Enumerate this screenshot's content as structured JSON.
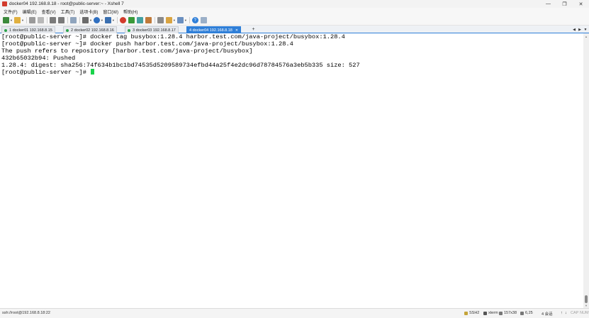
{
  "window": {
    "title": "docker04 192.168.8.18 - root@public-server:~ - Xshell 7"
  },
  "menu": [
    "文件(F)",
    "编辑(E)",
    "查看(V)",
    "工具(T)",
    "选项卡(B)",
    "窗口(W)",
    "帮助(H)"
  ],
  "tabs": [
    {
      "label": "1 docker01 192.168.8.15"
    },
    {
      "label": "2 docker02 192.168.8.16"
    },
    {
      "label": "3 docker03 192.168.8.17"
    },
    {
      "label": "4 docker04 192.168.8.18"
    }
  ],
  "terminal": {
    "lines": [
      "[root@public-server ~]# docker tag busybox:1.28.4 harbor.test.com/java-project/busybox:1.28.4",
      "[root@public-server ~]# docker push harbor.test.com/java-project/busybox:1.28.4",
      "The push refers to repository [harbor.test.com/java-project/busybox]",
      "432b65032b94: Pushed",
      "1.28.4: digest: sha256:74f634b1bc1bd74535d5209589734efbd44a25f4e2dc96d78784576a3eb5b335 size: 527"
    ],
    "prompt": "[root@public-server ~]# "
  },
  "status": {
    "connection": "ssh://root@192.168.8.18:22",
    "protocol": "SSH2",
    "terminal_type": "xterm",
    "size": "157x38",
    "cursor_pos": "6,25",
    "sessions": "4 会话",
    "cap": "CAP",
    "num": "NUM"
  },
  "colors": {
    "active_tab": "#2f7fd8",
    "cursor": "#19d34a",
    "session_dot": "#2ca24a"
  }
}
